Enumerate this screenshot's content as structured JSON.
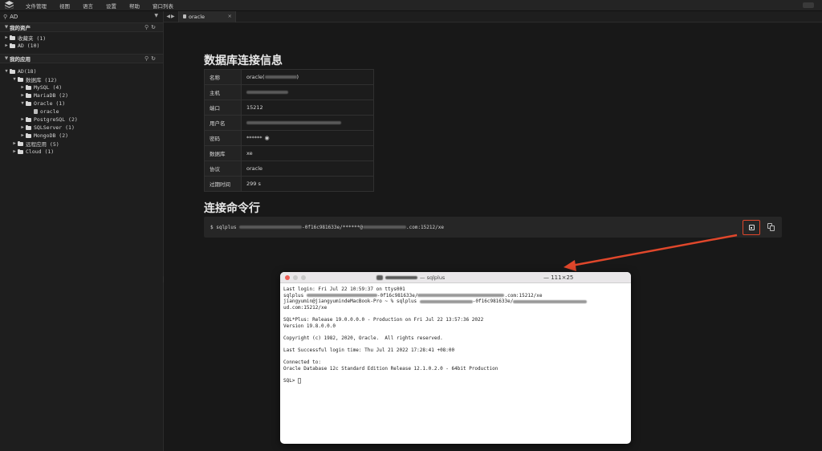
{
  "menubar": {
    "items": [
      "文件管理",
      "视图",
      "语言",
      "设置",
      "帮助",
      "窗口列表"
    ]
  },
  "sidebar": {
    "top_label": "AD",
    "assets_title": "我的资产",
    "assets": [
      {
        "label": "收藏夹 (1)"
      },
      {
        "label": "AD (10)"
      }
    ],
    "apps_title": "我的应用",
    "apps": {
      "root": "AD(18)",
      "db": "数据库 (12)",
      "mysql": "MySQL (4)",
      "mariadb": "MariaDB (2)",
      "oracle": "Oracle (1)",
      "oracle_leaf": "oracle",
      "postgres": "PostgreSQL (2)",
      "sqlserver": "SQLServer (1)",
      "mongodb": "MongoDB (2)",
      "remote": "远程应用 (5)",
      "cloud": "Cloud (1)"
    }
  },
  "tab": {
    "label": "oracle"
  },
  "main": {
    "title": "数据库连接信息",
    "rows": [
      {
        "key": "名称",
        "value": "oracle("
      },
      {
        "key": "主机",
        "value": ""
      },
      {
        "key": "端口",
        "value": "15212"
      },
      {
        "key": "用户名",
        "value": ""
      },
      {
        "key": "密码",
        "value": "******"
      },
      {
        "key": "数据库",
        "value": "xe"
      },
      {
        "key": "协议",
        "value": "oracle"
      },
      {
        "key": "过期时间",
        "value": "299 s"
      }
    ],
    "cmd_title": "连接命令行",
    "cmd_prefix": "$ sqlplus",
    "cmd_mid": "-0f16c981633e/******@",
    "cmd_suffix": ".com:15212/xe"
  },
  "terminal": {
    "title_suffix": "— sqlplus",
    "size": "— 111×25",
    "lines": {
      "l1": "Last login: Fri Jul 22 10:59:37 on ttys001",
      "l2a": "sqlplus ",
      "l2b": "-0f16c981633e/",
      "l2c": ".com:15212/xe",
      "l3a": "jiangyumin@jiangyumindeMacBook-Pro ~ % sqlplus ",
      "l3b": "-0f16c981633e/",
      "l4": "ud.com:15212/xe",
      "l6": "SQL*Plus: Release 19.0.0.0.0 - Production on Fri Jul 22 13:57:36 2022",
      "l7": "Version 19.8.0.0.0",
      "l9": "Copyright (c) 1982, 2020, Oracle.  All rights reserved.",
      "l11": "Last Successful login time: Thu Jul 21 2022 17:28:41 +08:00",
      "l13": "Connected to:",
      "l14": "Oracle Database 12c Standard Edition Release 12.1.0.2.0 - 64bit Production",
      "l16": "SQL> "
    }
  }
}
